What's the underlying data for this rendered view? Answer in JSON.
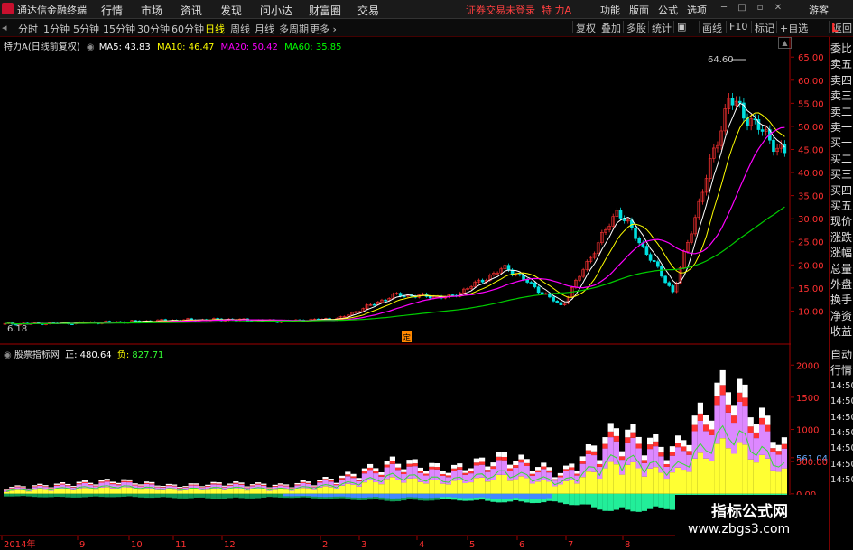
{
  "app": {
    "name": "通达信金融终端"
  },
  "menu": [
    "行情",
    "市场",
    "资讯",
    "发现",
    "问小达",
    "财富圈",
    "交易"
  ],
  "status_text": "证券交易未登录",
  "stock_name_header": "特 力A",
  "right_menu": [
    "功能",
    "版面",
    "公式",
    "选项"
  ],
  "user": "游客",
  "timeframes": [
    "分时",
    "1分钟",
    "5分钟",
    "15分钟",
    "30分钟",
    "60分钟",
    "日线",
    "周线",
    "月线",
    "多周期",
    "更多"
  ],
  "active_timeframe": "日线",
  "right_tools": [
    "复权",
    "叠加",
    "多股",
    "统计",
    "画线",
    "F10",
    "标记",
    "+自选",
    "返回"
  ],
  "main_legend": {
    "title": "特力A(日线前复权)",
    "ma": [
      {
        "label": "MA5: 43.83",
        "color": "#ffffff"
      },
      {
        "label": "MA10: 46.47",
        "color": "#ffff00"
      },
      {
        "label": "MA20: 50.42",
        "color": "#ff00ff"
      },
      {
        "label": "MA60: 35.85",
        "color": "#00ff00"
      }
    ]
  },
  "volume_legend": {
    "title": "股票指标网",
    "zheng_label": "正:",
    "zheng_value": "480.64",
    "fu_label": "负:",
    "fu_value": "827.71"
  },
  "annotations": {
    "high_label": "64.60",
    "low_label": "6.18",
    "marker": "定"
  },
  "yaxis_main": [
    "65.00",
    "60.00",
    "55.00",
    "50.00",
    "45.00",
    "40.00",
    "35.00",
    "30.00",
    "25.00",
    "20.00",
    "15.00",
    "10.00"
  ],
  "yaxis_vol": [
    "2000",
    "1500",
    "1000",
    "561.04",
    "500.00",
    "0.00"
  ],
  "xaxis": [
    "2014年",
    "9",
    "10",
    "11",
    "12",
    "2",
    "3",
    "4",
    "5",
    "6",
    "7",
    "8"
  ],
  "side_panel": {
    "top_items": [
      "委比",
      "卖五",
      "卖四",
      "卖三",
      "卖二",
      "卖一",
      "买一",
      "买二",
      "买三",
      "买四",
      "买五",
      "现价",
      "涨跌",
      "涨幅",
      "总量",
      "外盘",
      "换手",
      "净资",
      "收益"
    ],
    "bottom_items": [
      "自动",
      "行情",
      "14:50",
      "14:50",
      "14:50",
      "14:50",
      "14:50",
      "14:50",
      "14:50"
    ],
    "corner": "L"
  },
  "watermark": {
    "line1": "指标公式网",
    "line2": "www.zbgs3.com"
  },
  "chart_data": {
    "type": "candlestick",
    "title": "特力A(日线前复权)",
    "ylim": [
      5,
      67
    ],
    "x": [
      "2014年",
      "9",
      "10",
      "11",
      "12",
      "2",
      "3",
      "4",
      "5",
      "6",
      "7",
      "8"
    ],
    "close": [
      7.2,
      7.4,
      7.6,
      8.0,
      8.2,
      7.8,
      8.4,
      13.5,
      13.0,
      19.5,
      11.0,
      32.0,
      14.0,
      56.0,
      44.0
    ],
    "ma5_last": 43.83,
    "ma10_last": 46.47,
    "ma20_last": 50.42,
    "ma60_last": 35.85,
    "high": 64.6,
    "low": 6.18,
    "volume_ylim": [
      -550,
      2200
    ],
    "volume": [
      120,
      180,
      250,
      150,
      200,
      160,
      300,
      600,
      450,
      700,
      380,
      1200,
      800,
      2100,
      900
    ],
    "negative_flow": [
      -40,
      -60,
      -50,
      -70,
      -80,
      -60,
      -90,
      -120,
      -100,
      -140,
      -150,
      -300,
      -250,
      -500,
      -350
    ]
  }
}
